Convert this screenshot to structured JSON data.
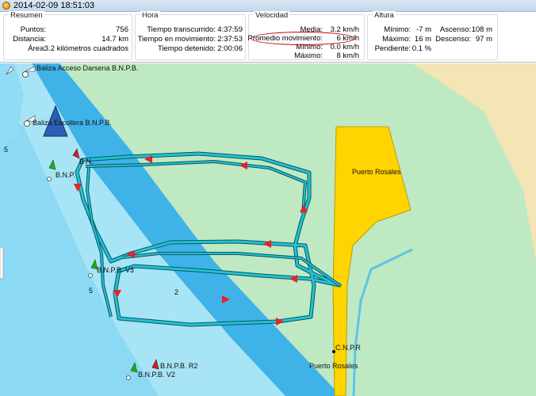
{
  "window": {
    "title": "2014-02-09 18:51:03"
  },
  "summary": {
    "legend": "Resumen",
    "points_label": "Puntos:",
    "points_value": "756",
    "distance_label": "Distancia:",
    "distance_value": "14.7 km",
    "area_label": "Área:",
    "area_value": "3.2 kilómetros cuadrados"
  },
  "time": {
    "legend": "Hora",
    "elapsed_label": "Tiempo transcurrido:",
    "elapsed_value": "4:37:59",
    "moving_label": "Tiempo en movimiento:",
    "moving_value": "2:37:53",
    "stopped_label": "Tiempo detenido:",
    "stopped_value": "2:00:06"
  },
  "speed": {
    "legend": "Velocidad",
    "mean_label": "Media:",
    "mean_value": "3.2 km/h",
    "moving_avg_label": "Promedio movimiento:",
    "moving_avg_value": "6 km/h",
    "min_label": "Mínimo:",
    "min_value": "0.0 km/h",
    "max_label": "Máximo:",
    "max_value": "8 km/h",
    "highlight_color": "#cc0000"
  },
  "altitude": {
    "legend": "Altura",
    "min_label": "Mínimo:",
    "min_value": "-7 m",
    "max_label": "Máximo:",
    "max_value": "16 m",
    "slope_label": "Pendiente:",
    "slope_value": "0.1 %",
    "ascent_label": "Ascenso:",
    "ascent_value": "108 m",
    "descent_label": "Descenso:",
    "descent_value": "97 m"
  },
  "map": {
    "labels": {
      "baliza_darsena": "Baliza Acceso Darsena B.N.P.B.",
      "baliza_escollera": "Baliza Escollera B.N.P.B.",
      "bnp": "B.N.P.",
      "bnp_top": "B.N.",
      "bnpb_v3": "B.N.P.B. V3",
      "bnpb_r2": "B.N.P.B. R2",
      "bnpb_v2": "B.N.P.B. V2",
      "puerto_rosales_top": "Puerto Rosales",
      "puerto_rosales_bottom": "Puerto Rosales",
      "cnpr": "C.N.P.R",
      "depth_5a": "5",
      "depth_5b": "5",
      "depth_2": "2"
    },
    "colors": {
      "land": "#f3e6b4",
      "intertidal": "#bfe9c2",
      "shallow": "#a7e4f5",
      "channel": "#3fb2e8",
      "deep": "#7fd4f3",
      "port": "#ffd400",
      "track": "#1fc3d4",
      "track_arrow": "#e8202a",
      "buoy_green": "#22aa22",
      "buoy_red": "#cc2222",
      "position_marker": "#2a5fb4"
    }
  }
}
